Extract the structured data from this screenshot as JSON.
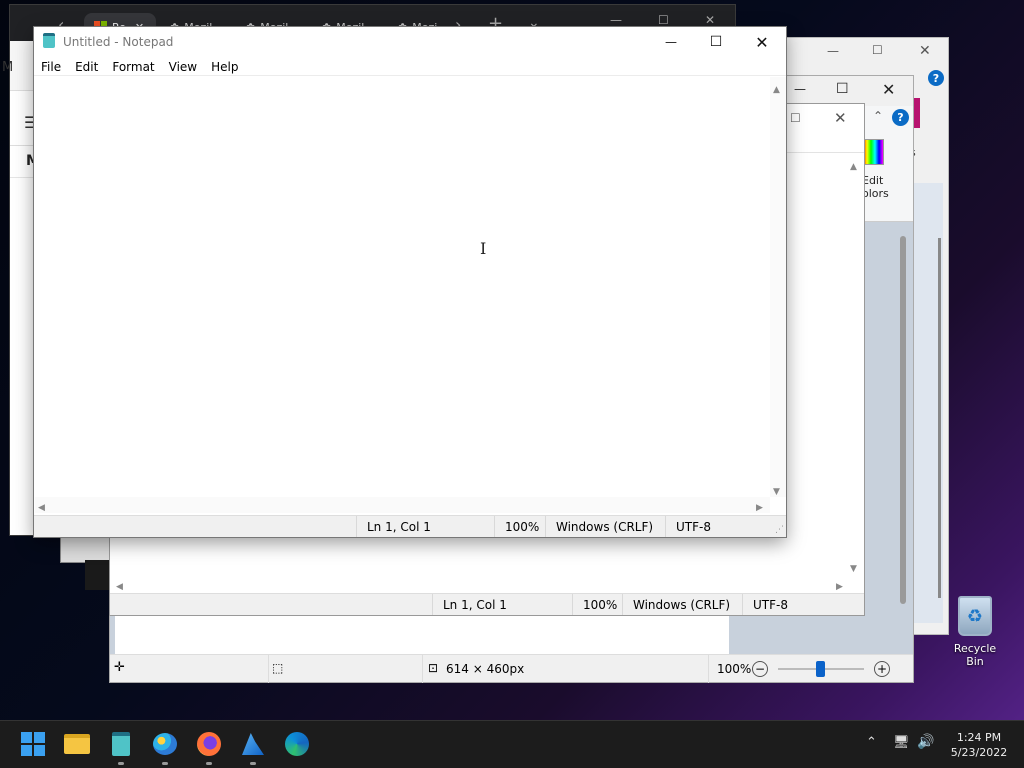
{
  "browser": {
    "tabs": [
      {
        "label": "Re",
        "icon": "microsoft-logo-icon"
      },
      {
        "label": "Mozil",
        "icon": "mozilla-icon"
      },
      {
        "label": "Mozil",
        "icon": "mozilla-icon"
      },
      {
        "label": "Mozil",
        "icon": "mozilla-icon"
      },
      {
        "label": "Mozi",
        "icon": "mozilla-icon"
      }
    ],
    "left_letters": [
      "M",
      "M"
    ]
  },
  "paint": {
    "edit_colors_label_1": "Edit",
    "edit_colors_label_2": "olors",
    "side_letters": "s",
    "status": {
      "image_size": "614 × 460px",
      "zoom": "100%"
    },
    "help_glyph": "?"
  },
  "notepad_back": {
    "status": {
      "position": "Ln 1, Col 1",
      "zoom": "100%",
      "line_ending": "Windows (CRLF)",
      "encoding": "UTF-8"
    }
  },
  "notepad": {
    "title": "Untitled - Notepad",
    "menu": [
      "File",
      "Edit",
      "Format",
      "View",
      "Help"
    ],
    "status": {
      "position": "Ln 1, Col 1",
      "zoom": "100%",
      "line_ending": "Windows (CRLF)",
      "encoding": "UTF-8"
    }
  },
  "desktop": {
    "recycle_bin_label": "Recycle Bin"
  },
  "taskbar": {
    "apps": [
      "start-icon",
      "file-explorer-icon",
      "notepad-icon",
      "paint-icon",
      "firefox-icon",
      "snipping-icon",
      "edge-icon"
    ],
    "clock_time": "1:24 PM",
    "clock_date": "5/23/2022"
  },
  "colors": {
    "accent": "#0067c0",
    "taskbar": "#1c1c1c",
    "notepad_icon": "#4fc3c7"
  }
}
